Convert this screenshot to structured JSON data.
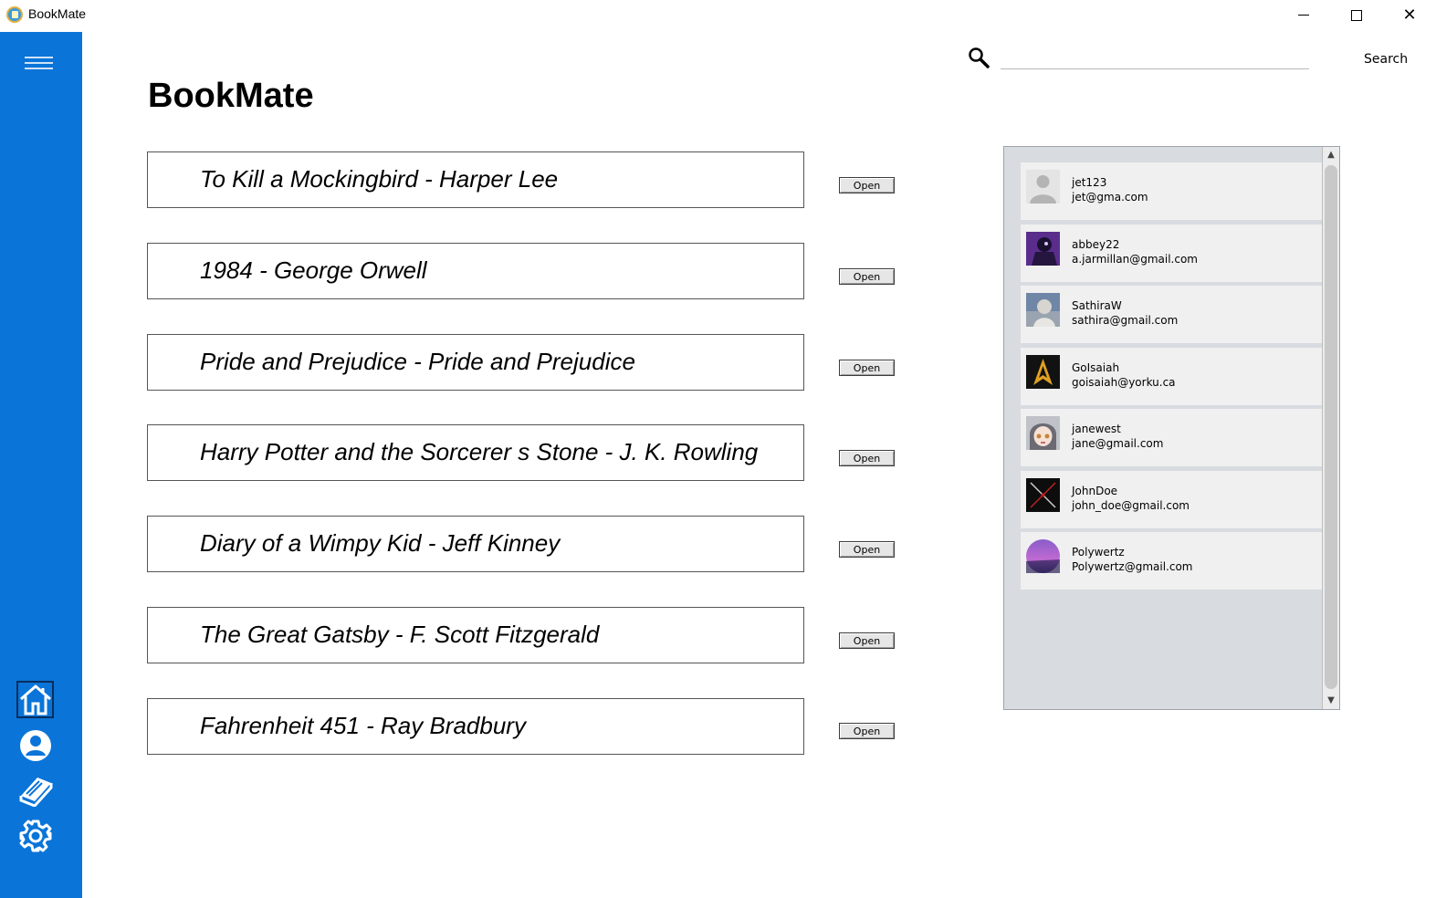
{
  "window": {
    "title": "BookMate",
    "min_glyph": "",
    "close_glyph": "✕"
  },
  "search": {
    "placeholder": "",
    "value": "",
    "button_label": "Search"
  },
  "main": {
    "title": "BookMate"
  },
  "books": [
    {
      "label": "To Kill a Mockingbird - Harper Lee",
      "open_label": "Open"
    },
    {
      "label": "1984 - George Orwell",
      "open_label": "Open"
    },
    {
      "label": "Pride and Prejudice - Pride and Prejudice",
      "open_label": "Open"
    },
    {
      "label": "Harry Potter and the Sorcerer s Stone - J. K. Rowling",
      "open_label": "Open"
    },
    {
      "label": "Diary of a Wimpy Kid - Jeff Kinney",
      "open_label": "Open"
    },
    {
      "label": "The Great Gatsby - F. Scott Fitzgerald",
      "open_label": "Open"
    },
    {
      "label": "Fahrenheit 451 - Ray Bradbury",
      "open_label": "Open"
    }
  ],
  "users": [
    {
      "name": "jet123",
      "email": "jet@gma.com",
      "avatar": "default-person"
    },
    {
      "name": "abbey22",
      "email": "a.jarmillan@gmail.com",
      "avatar": "purple-figure"
    },
    {
      "name": "SathiraW",
      "email": "sathira@gmail.com",
      "avatar": "grey-figure"
    },
    {
      "name": "GoIsaiah",
      "email": "goisaiah@yorku.ca",
      "avatar": "starfleet-emblem"
    },
    {
      "name": "janewest",
      "email": "jane@gmail.com",
      "avatar": "anime-girl"
    },
    {
      "name": "JohnDoe",
      "email": "john_doe@gmail.com",
      "avatar": "crossed-swords"
    },
    {
      "name": "Polywertz",
      "email": "Polywertz@gmail.com",
      "avatar": "purple-sky"
    }
  ],
  "colors": {
    "sidebar": "#0a74d8",
    "panel": "#d8dbe0",
    "card": "#f0f0f0"
  },
  "icons": {
    "menu": "hamburger-icon",
    "home": "home-icon",
    "profile": "user-icon",
    "library": "book-icon",
    "settings": "gear-icon",
    "search": "search-icon"
  }
}
